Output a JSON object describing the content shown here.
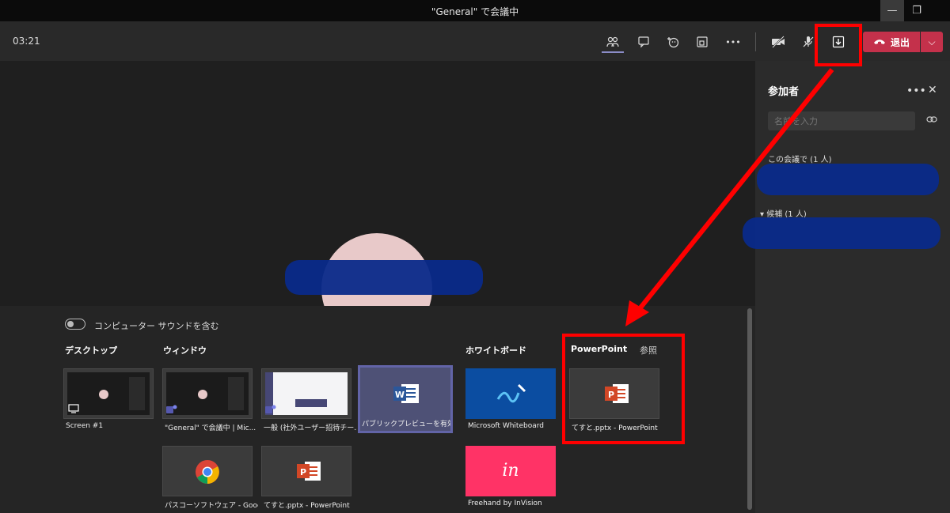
{
  "window": {
    "title": "\"General\" で会議中",
    "minimize": "—",
    "restore": "❐"
  },
  "toolbar": {
    "timer": "03:21",
    "more": "•••",
    "leave_label": "退出",
    "leave_dropdown": "⌵"
  },
  "panel": {
    "title": "参加者",
    "more": "•••",
    "close": "✕",
    "search_placeholder": "名前を入力",
    "section_meeting": "この会議で (1 人)",
    "section_suggested": "候補 (1 人)",
    "suggested_caret": "▾"
  },
  "share": {
    "sound_toggle_label": "コンピューター サウンドを含む",
    "sections": {
      "desktop": "デスクトップ",
      "window": "ウィンドウ",
      "whiteboard": "ホワイトボード",
      "powerpoint": "PowerPoint",
      "browse": "参照"
    },
    "tiles": {
      "screen1": "Screen #1",
      "general_window": "\"General\" で会議中 | Mic...",
      "general_channel": "一般 (社外ユーザー招待チー...",
      "public_preview": "パブリックプレビューを有効に...",
      "chrome": "パスコーソフトウェア - Googl...",
      "ppt_window": "てすと.pptx - PowerPoint",
      "whiteboard": "Microsoft Whiteboard",
      "invision": "Freehand by InVision",
      "invision_logo": "in",
      "ppt_file": "てすと.pptx - PowerPoint"
    }
  },
  "colors": {
    "leave_red": "#c4314b",
    "teams_purple": "#6264a7",
    "highlight_red": "#ff0000",
    "whiteboard_blue": "#0b4da1",
    "invision_pink": "#ff3366"
  }
}
